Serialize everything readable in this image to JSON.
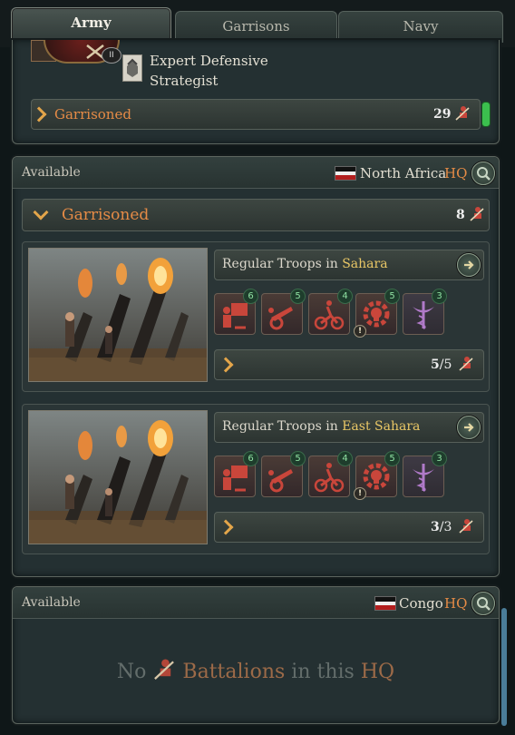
{
  "tabs": [
    {
      "label": "Army"
    },
    {
      "label": "Garrisons"
    },
    {
      "label": "Navy"
    }
  ],
  "commander": {
    "trait_line1": "Expert Defensive",
    "trait_line2": "Strategist",
    "level_badge": "II",
    "garrisoned_label": "Garrisoned",
    "garrisoned_count": "29"
  },
  "hq1": {
    "status": "Available",
    "region": "North Africa",
    "hq_label": "HQ",
    "garrisoned_label": "Garrisoned",
    "garrisoned_count": "8",
    "groups": [
      {
        "title_prefix": "Regular Troops in",
        "location": "Sahara",
        "count_current": "5",
        "count_sep": "/",
        "count_total": "5",
        "icons": [
          {
            "name": "instructor-icon",
            "level": "6"
          },
          {
            "name": "artillery-icon",
            "level": "5"
          },
          {
            "name": "cyclist-icon",
            "level": "4"
          },
          {
            "name": "gear-skull-icon",
            "level": "5"
          },
          {
            "name": "medic-icon",
            "level": "3"
          }
        ]
      },
      {
        "title_prefix": "Regular Troops in",
        "location": "East Sahara",
        "count_current": "3",
        "count_sep": "/",
        "count_total": "3",
        "icons": [
          {
            "name": "instructor-icon",
            "level": "6"
          },
          {
            "name": "artillery-icon",
            "level": "5"
          },
          {
            "name": "cyclist-icon",
            "level": "4"
          },
          {
            "name": "gear-skull-icon",
            "level": "5"
          },
          {
            "name": "medic-icon",
            "level": "3"
          }
        ]
      }
    ]
  },
  "hq2": {
    "status": "Available",
    "region": "Congo",
    "hq_label": "HQ",
    "empty_no": "No",
    "empty_battalions": "Battalions",
    "empty_in_this": "in this",
    "empty_hq": "HQ"
  },
  "colors": {
    "accent_orange": "#e58b46",
    "accent_yellow": "#e9c766",
    "badge_green": "#8fe0a2",
    "toggle_green": "#3bbf4e"
  }
}
